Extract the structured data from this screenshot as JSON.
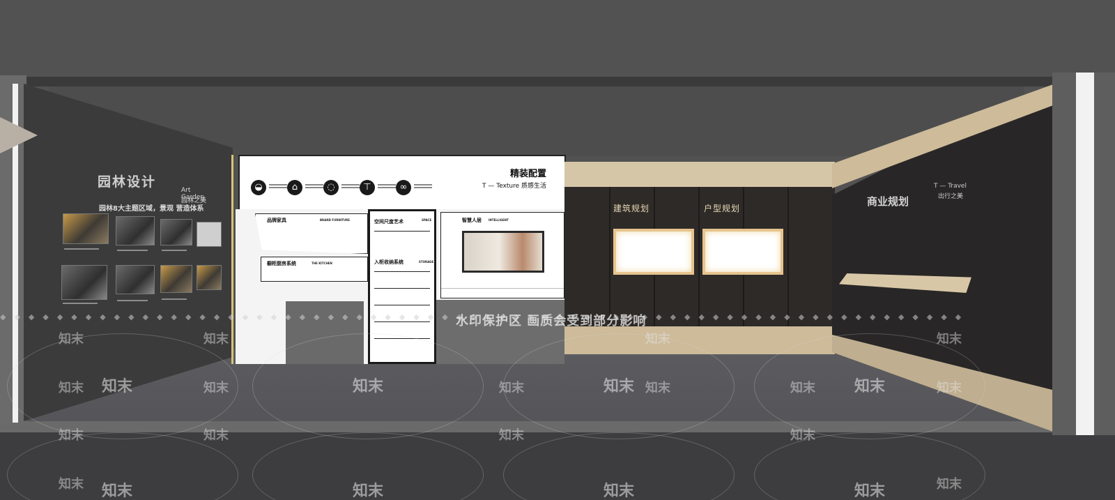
{
  "left_wall": {
    "title": "园林设计",
    "subtitle": "园林8大主题区域，景观 营造体系",
    "side_label_en": "Art Garden",
    "side_label_cn": "园林之美"
  },
  "center": {
    "header_title": "精装配置",
    "header_subtitle": "T — Texture 质感生活",
    "header_icons": [
      "bathtub-icon",
      "hanger-icon",
      "bulb-icon",
      "faucet-icon",
      "link-icon"
    ],
    "panel_brand_title": "品牌家具",
    "panel_brand_tag": "BRAND FURNITURE",
    "panel_kitchen_title": "橱柜厨房系统",
    "panel_kitchen_tag": "THE KITCHEN",
    "panel_space_title": "空间尺度艺术",
    "panel_space_tag": "SPACE",
    "panel_storage_title": "入柜收纳系统",
    "panel_storage_tag": "STORAGE",
    "panel_smart_title": "智慧人居",
    "panel_smart_tag": "INTELLIGENT"
  },
  "wood_wall": {
    "label_1": "建筑规划",
    "label_2": "户型规划"
  },
  "right_wall": {
    "title": "商业规划",
    "sub_en": "T — Travel",
    "sub_cn": "出行之美"
  },
  "watermark": {
    "banner": "水印保护区  画质会受到部分影响",
    "brand": "知末"
  }
}
